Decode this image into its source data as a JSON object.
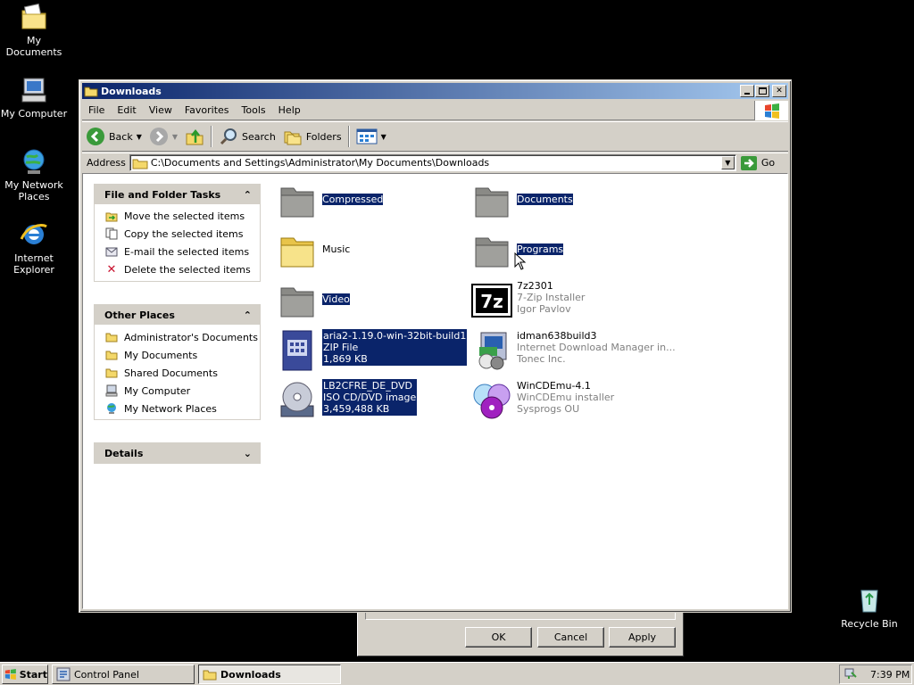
{
  "desktop": {
    "icons": [
      {
        "label": "My Documents"
      },
      {
        "label": "My Computer"
      },
      {
        "label": "My Network Places"
      },
      {
        "label": "Internet Explorer"
      },
      {
        "label": "Recycle Bin"
      }
    ]
  },
  "background_dialog": {
    "ok": "OK",
    "cancel": "Cancel",
    "apply": "Apply"
  },
  "window": {
    "title": "Downloads",
    "menu": [
      "File",
      "Edit",
      "View",
      "Favorites",
      "Tools",
      "Help"
    ],
    "toolbar": {
      "back": "Back",
      "search": "Search",
      "folders": "Folders"
    },
    "address": {
      "label": "Address",
      "value": "C:\\Documents and Settings\\Administrator\\My Documents\\Downloads",
      "go": "Go"
    },
    "tasks": {
      "file_folder": {
        "title": "File and Folder Tasks",
        "items": [
          "Move the selected items",
          "Copy the selected items",
          "E-mail the selected items",
          "Delete the selected items"
        ]
      },
      "other_places": {
        "title": "Other Places",
        "items": [
          "Administrator's Documents",
          "My Documents",
          "Shared Documents",
          "My Computer",
          "My Network Places"
        ]
      },
      "details": {
        "title": "Details"
      }
    },
    "files": [
      {
        "name": "Compressed",
        "type": "folder",
        "selected": true
      },
      {
        "name": "Documents",
        "type": "folder",
        "selected": true
      },
      {
        "name": "Music",
        "type": "folder",
        "selected": false
      },
      {
        "name": "Programs",
        "type": "folder",
        "selected": true
      },
      {
        "name": "Video",
        "type": "folder",
        "selected": true
      },
      {
        "name": "7z2301",
        "line2": "7-Zip Installer",
        "line3": "Igor Pavlov",
        "selected": false
      },
      {
        "name": "aria2-1.19.0-win-32bit-build1",
        "line2": "ZIP File",
        "line3": "1,869 KB",
        "selected": true
      },
      {
        "name": "idman638build3",
        "line2": "Internet Download Manager in...",
        "line3": "Tonec Inc.",
        "selected": false
      },
      {
        "name": "LB2CFRE_DE_DVD",
        "line2": "ISO CD/DVD image",
        "line3": "3,459,488 KB",
        "selected": true
      },
      {
        "name": "WinCDEmu-4.1",
        "line2": "WinCDEmu installer",
        "line3": "Sysprogs OU",
        "selected": false
      }
    ]
  },
  "taskbar": {
    "start": "Start",
    "tasks": [
      {
        "label": "Control Panel"
      },
      {
        "label": "Downloads",
        "active": true
      }
    ],
    "clock": "7:39 PM"
  }
}
